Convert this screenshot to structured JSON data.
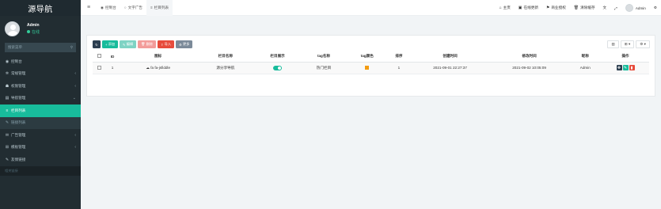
{
  "sidebar": {
    "logo": "源导航",
    "user": {
      "name": "Admin",
      "status": "在线"
    },
    "search_placeholder": "搜索菜单",
    "items": [
      {
        "label": "控制台",
        "icon": "dashboard-icon",
        "glyph": "◉",
        "chevron": ""
      },
      {
        "label": "常规管理",
        "icon": "cogs-icon",
        "glyph": "✲",
        "chevron": "‹"
      },
      {
        "label": "权限管理",
        "icon": "group-icon",
        "glyph": "☗",
        "chevron": "‹"
      },
      {
        "label": "导航管理",
        "icon": "list-icon",
        "glyph": "▤",
        "chevron": "⌄"
      },
      {
        "label": "栏目列表",
        "icon": "bars-icon",
        "glyph": "≡",
        "chevron": ""
      },
      {
        "label": "链接列表",
        "icon": "link-icon",
        "glyph": "✎",
        "chevron": ""
      },
      {
        "label": "广告管理",
        "icon": "megaphone-icon",
        "glyph": "✉",
        "chevron": "‹"
      },
      {
        "label": "模板管理",
        "icon": "sitemap-icon",
        "glyph": "⊞",
        "chevron": "‹"
      },
      {
        "label": "友情链接",
        "icon": "pencil-icon",
        "glyph": "✎",
        "chevron": ""
      }
    ],
    "footer_header": "相关链接"
  },
  "topbar": {
    "tabs": [
      {
        "label": "控制台",
        "glyph": "◉"
      },
      {
        "label": "文字广告",
        "glyph": "○"
      },
      {
        "label": "栏目列表",
        "glyph": "≡"
      }
    ],
    "links": [
      {
        "label": "主页",
        "glyph": "⌂"
      },
      {
        "label": "在线更新",
        "glyph": "▣"
      },
      {
        "label": "商业授权",
        "glyph": "⚑"
      },
      {
        "label": "清除缓存",
        "glyph": "🗑"
      }
    ],
    "user": "Admin"
  },
  "toolbar": {
    "add": "添加",
    "edit": "编辑",
    "delete": "删除",
    "import": "导入",
    "more": "更多",
    "refresh_glyph": "↻",
    "columns_glyph": "▥",
    "export_glyph": "⊞",
    "settings_glyph": "⚙"
  },
  "table": {
    "headers": [
      "ID",
      "图标",
      "栏目名称",
      "栏目展示",
      "tag名称",
      "tag颜色",
      "排序",
      "创建时间",
      "修改时间",
      "昵称",
      "操作"
    ],
    "rows": [
      {
        "id": "1",
        "icon_text": "fa fa-jsfiddle",
        "name": "源分享导航",
        "tag_name": "热门栏目",
        "tag_color": "#f39c12",
        "sort": "1",
        "created": "2021-09-01 22:27:37",
        "modified": "2021-09-02 10:05:09",
        "nickname": "Admin"
      }
    ]
  },
  "colors": {
    "accent": "#18bc9c",
    "sidebar_bg": "#222d32",
    "danger": "#e74c3c"
  }
}
